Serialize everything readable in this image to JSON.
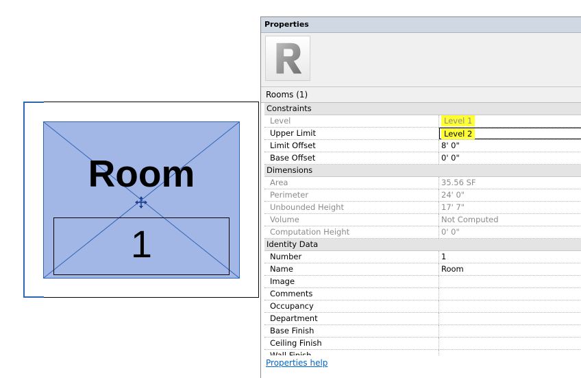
{
  "canvas": {
    "room_name": "Room",
    "room_number": "1",
    "icons": {
      "move": "move-icon"
    },
    "colors": {
      "room_fill": "#a3b7e6",
      "selection": "#2f63b6"
    }
  },
  "properties": {
    "title": "Properties",
    "instance_selector": "Rooms (1)",
    "help_link": "Properties help",
    "icons": {
      "type_image": "revit-logo-icon"
    },
    "groups": [
      {
        "label": "Constraints",
        "rows": [
          {
            "name": "Level",
            "value": "Level 1",
            "disabled": true,
            "highlight": true
          },
          {
            "name": "Upper Limit",
            "value": "Level 2",
            "disabled": false,
            "highlight": true,
            "editing": true
          },
          {
            "name": "Limit Offset",
            "value": "8'  0\"",
            "disabled": false
          },
          {
            "name": "Base Offset",
            "value": "0'  0\"",
            "disabled": false
          }
        ]
      },
      {
        "label": "Dimensions",
        "rows": [
          {
            "name": "Area",
            "value": "35.56 SF",
            "disabled": true
          },
          {
            "name": "Perimeter",
            "value": "24'  0\"",
            "disabled": true
          },
          {
            "name": "Unbounded Height",
            "value": "17'  7\"",
            "disabled": true
          },
          {
            "name": "Volume",
            "value": "Not Computed",
            "disabled": true
          },
          {
            "name": "Computation Height",
            "value": "0'  0\"",
            "disabled": true
          }
        ]
      },
      {
        "label": "Identity Data",
        "rows": [
          {
            "name": "Number",
            "value": "1",
            "disabled": false
          },
          {
            "name": "Name",
            "value": "Room",
            "disabled": false
          },
          {
            "name": "Image",
            "value": "",
            "disabled": false
          },
          {
            "name": "Comments",
            "value": "",
            "disabled": false
          },
          {
            "name": "Occupancy",
            "value": "",
            "disabled": false
          },
          {
            "name": "Department",
            "value": "",
            "disabled": false
          },
          {
            "name": "Base Finish",
            "value": "",
            "disabled": false
          },
          {
            "name": "Ceiling Finish",
            "value": "",
            "disabled": false
          },
          {
            "name": "Wall Finish",
            "value": "",
            "disabled": false
          }
        ]
      }
    ],
    "colors": {
      "highlight": "#ffff33",
      "titlebar": "#cfd8e3"
    }
  }
}
